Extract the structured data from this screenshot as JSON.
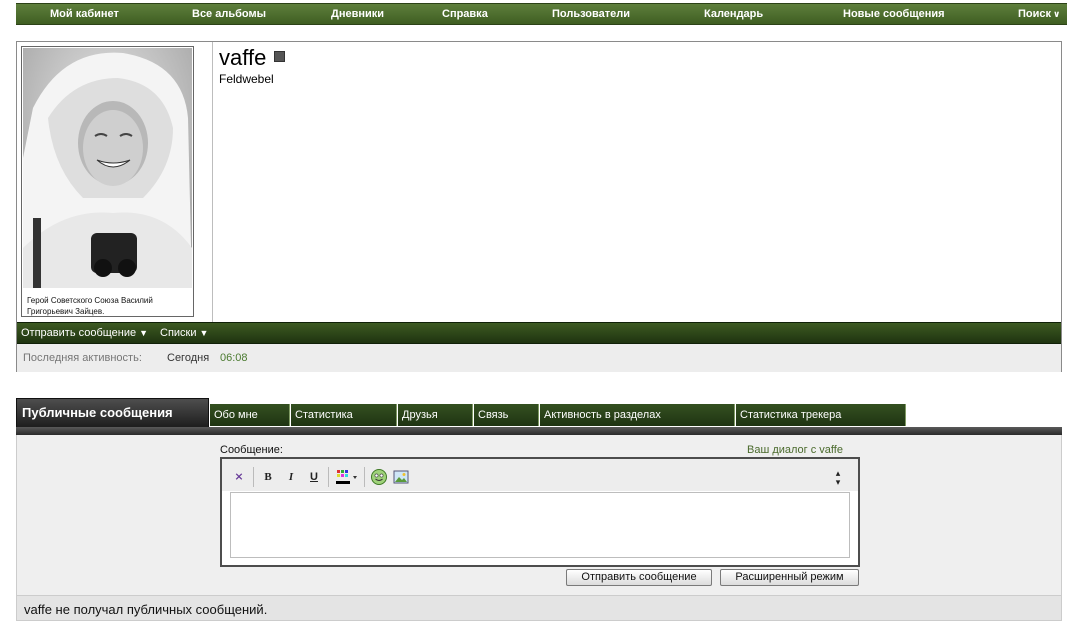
{
  "nav": {
    "items": [
      {
        "label": "Мой кабинет"
      },
      {
        "label": "Все альбомы"
      },
      {
        "label": "Дневники"
      },
      {
        "label": "Справка"
      },
      {
        "label": "Пользователи"
      },
      {
        "label": "Календарь"
      },
      {
        "label": "Новые сообщения"
      },
      {
        "label": "Поиск"
      }
    ]
  },
  "profile": {
    "username": "vaffe",
    "usertitle": "Feldwebel",
    "avatar_caption": "Герой Советского Союза Василий Григорьевич Зайцев.",
    "bar": {
      "send_message": "Отправить сообщение",
      "lists": "Списки"
    },
    "activity": {
      "label": "Последняя активность:",
      "day": "Сегодня",
      "time": "06:08"
    }
  },
  "tabs": [
    {
      "label": "Публичные сообщения",
      "active": true
    },
    {
      "label": "Обо мне"
    },
    {
      "label": "Статистика"
    },
    {
      "label": "Друзья"
    },
    {
      "label": "Связь"
    },
    {
      "label": "Активность в разделах"
    },
    {
      "label": "Статистика трекера"
    }
  ],
  "message_form": {
    "label": "Сообщение:",
    "dialog_link": "Ваш диалог с vaffe",
    "toolbar": {
      "bold": "B",
      "italic": "I",
      "underline": "U"
    },
    "submit": "Отправить сообщение",
    "advanced": "Расширенный режим"
  },
  "empty_state": "vaffe не получал публичных сообщений."
}
